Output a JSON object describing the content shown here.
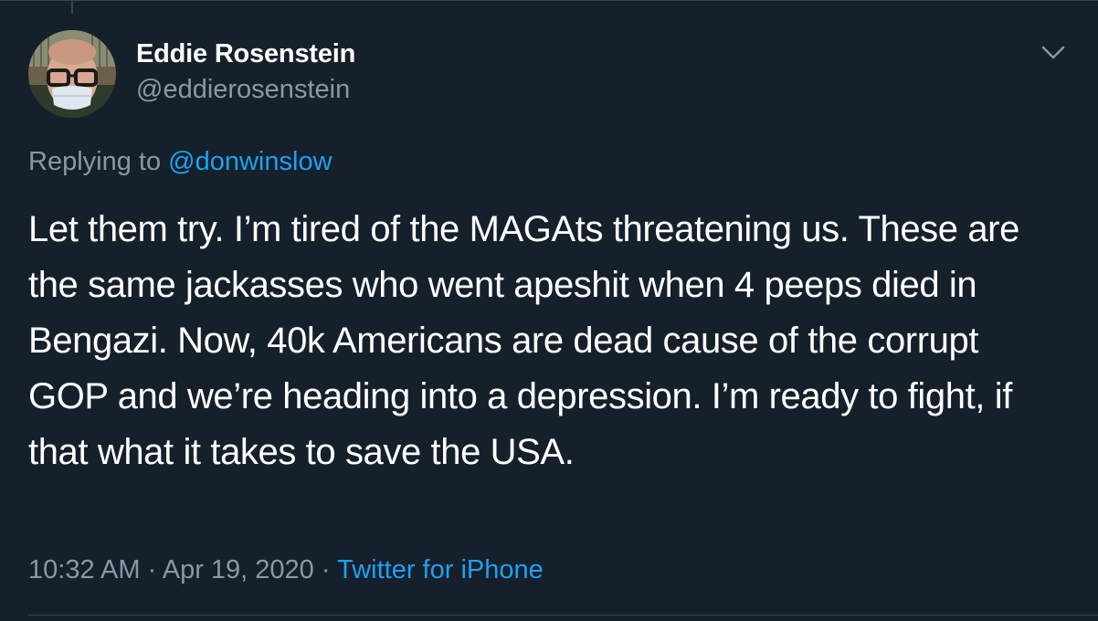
{
  "author": {
    "display_name": "Eddie Rosenstein",
    "handle": "@eddierosenstein",
    "avatar": "profile-photo"
  },
  "reply": {
    "prefix": "Replying to",
    "to_handle": "@donwinslow"
  },
  "tweet": {
    "text": "Let them try. I’m tired of the MAGAts threatening us. These are the same jackasses who went apeshit when 4 peeps died in Bengazi. Now, 40k Americans are dead cause of the corrupt GOP and we’re heading into a depression. I’m ready to fight, if that what it takes to save the USA.",
    "time": "10:32 AM",
    "separator": "·",
    "date": "Apr 19, 2020",
    "source": "Twitter for iPhone"
  },
  "icons": {
    "more": "chevron-down-icon"
  },
  "colors": {
    "background": "#15202b",
    "primary_text": "#ffffff",
    "secondary_text": "#8899a6",
    "link": "#1da1f2",
    "divider": "#38444d"
  }
}
